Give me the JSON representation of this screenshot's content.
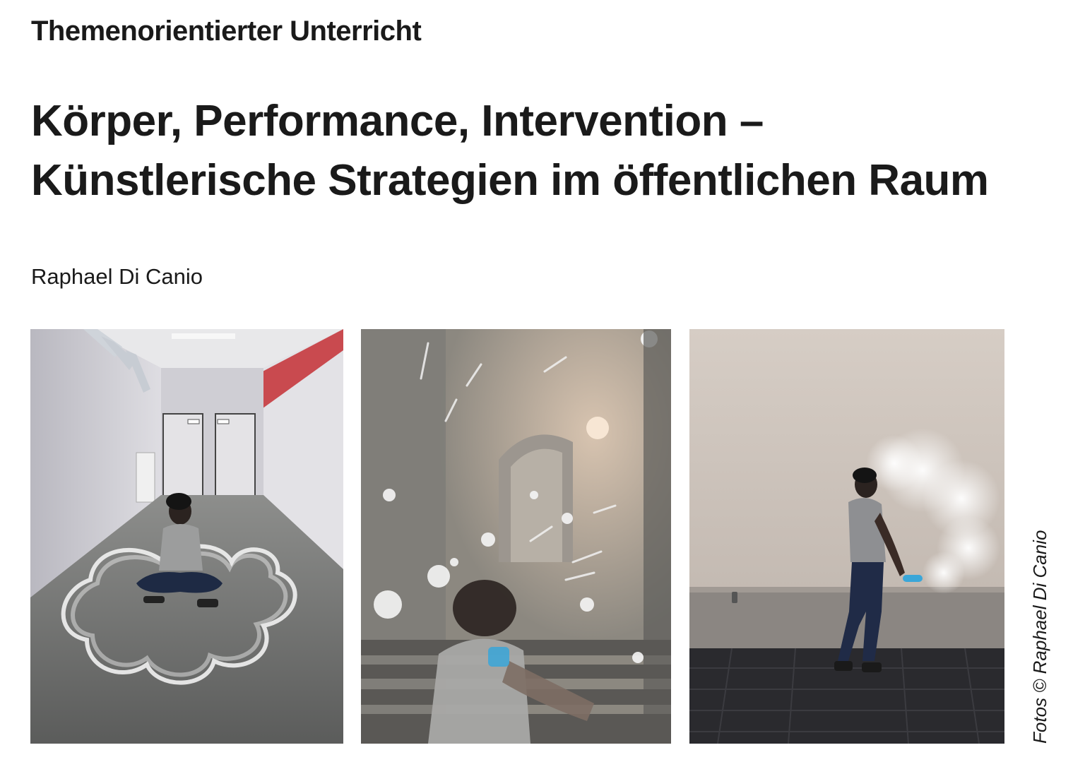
{
  "header": {
    "section": "Themenorientierter Unterricht",
    "title_line1": "Körper, Performance, Intervention –",
    "title_line2": "Künstlerische Strategien im öffentlichen Raum",
    "author": "Raphael Di Canio"
  },
  "photos": {
    "credit": "Fotos © Raphael Di Canio"
  }
}
